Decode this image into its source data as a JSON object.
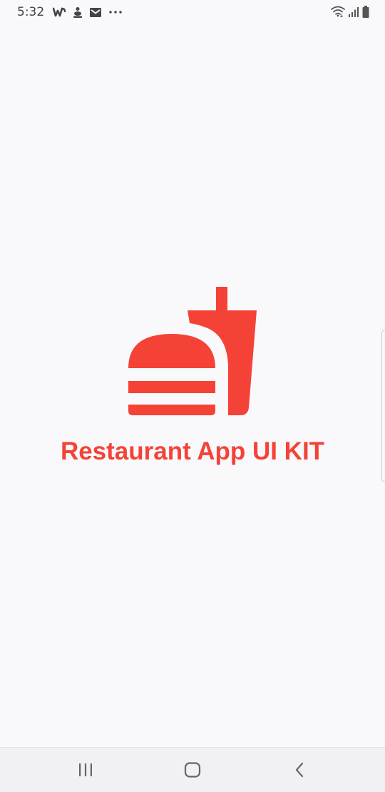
{
  "status_bar": {
    "time": "5:32",
    "left_icons": [
      "wattpad-icon",
      "notification-app-icon",
      "mail-icon",
      "more-dots-icon"
    ],
    "right_icons": [
      "wifi-icon",
      "signal-icon",
      "battery-icon"
    ]
  },
  "splash": {
    "logo_icon": "burger-and-drink-icon",
    "title": "Restaurant App UI KIT",
    "accent_color": "#f44336",
    "background_color": "#f9f9fc"
  },
  "nav_bar": {
    "buttons": [
      "recent-apps-icon",
      "home-icon",
      "back-icon"
    ]
  }
}
